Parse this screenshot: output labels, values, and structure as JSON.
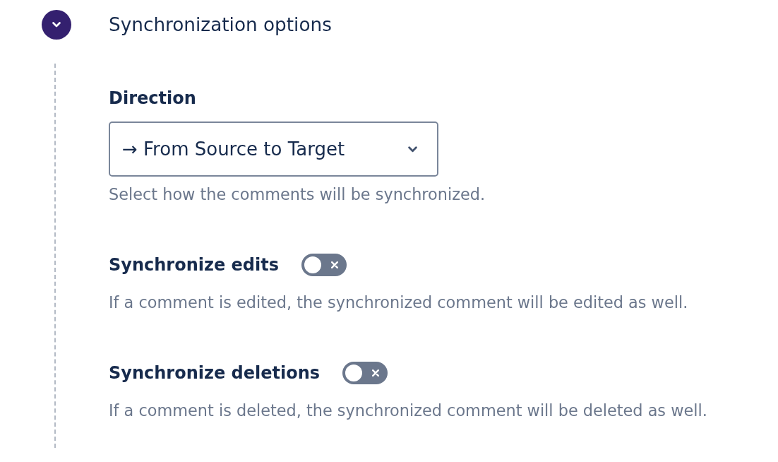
{
  "section": {
    "title": "Synchronization options",
    "expanded": true
  },
  "direction": {
    "label": "Direction",
    "value": "→ From Source to Target",
    "help": "Select how the comments will be synchronized."
  },
  "options": [
    {
      "label": "Synchronize edits",
      "on": false,
      "help": "If a comment is edited, the synchronized comment will be edited as well."
    },
    {
      "label": "Synchronize deletions",
      "on": false,
      "help": "If a comment is deleted, the synchronized comment will be deleted as well."
    }
  ]
}
